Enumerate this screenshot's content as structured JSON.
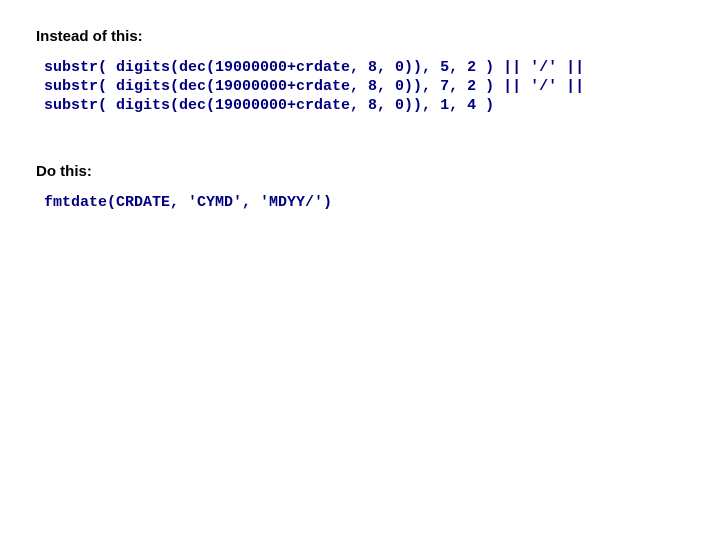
{
  "heading1": "Instead of this:",
  "code1": "substr( digits(dec(19000000+crdate, 8, 0)), 5, 2 ) || '/' ||\nsubstr( digits(dec(19000000+crdate, 8, 0)), 7, 2 ) || '/' ||\nsubstr( digits(dec(19000000+crdate, 8, 0)), 1, 4 )",
  "heading2": "Do this:",
  "code2": "fmtdate(CRDATE, 'CYMD', 'MDYY/')"
}
